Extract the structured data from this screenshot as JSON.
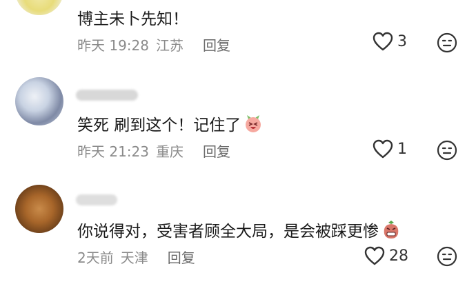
{
  "comments": [
    {
      "text": "博主未卜先知！",
      "date": "昨天 19:28",
      "location": "江苏",
      "reply_label": "回复",
      "likes": "3"
    },
    {
      "text": "笑死 刷到这个！记住了",
      "date": "昨天 21:23",
      "location": "重庆",
      "reply_label": "回复",
      "likes": "1"
    },
    {
      "text": "你说得对，受害者顾全大局，是会被踩更惨",
      "date": "2天前",
      "location": "天津",
      "reply_label": "回复",
      "likes": "28"
    }
  ],
  "colors": {
    "meta_text": "#8a8a8a",
    "icon": "#333333",
    "emoji_pink": "#f6a9a0"
  },
  "icons": {
    "like": "heart-outline-icon",
    "dislike": "meh-face-icon",
    "reaction_1": "laughing-cat-emoji",
    "reaction_2": "grimace-emoji"
  }
}
